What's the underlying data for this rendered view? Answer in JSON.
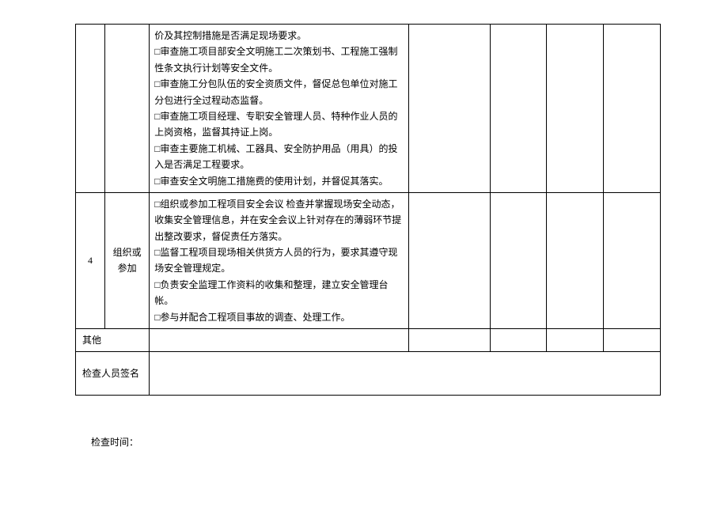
{
  "row3": {
    "items": [
      "价及其控制措施是否满足现场要求。",
      "□审查施工项目部安全文明施工二次策划书、工程施工强制性条文执行计划等安全文件。",
      "□审查施工分包队伍的安全资质文件，督促总包单位对施工分包进行全过程动态监督。",
      "□审查施工项目经理、专职安全管理人员、特种作业人员的上岗资格，监督其持证上岗。",
      "□审查主要施工机械、工器具、安全防护用品（用具）的投入是否满足工程要求。",
      "□审查安全文明施工措施费的使用计划，并督促其落实。"
    ]
  },
  "row4": {
    "index": "4",
    "category": "组织或参加",
    "items": [
      "□组织或参加工程项目安全会议 检查并掌握现场安全动态，收集安全管理信息，并在安全会议上针对存在的薄弱环节提出整改要求，督促责任方落实。",
      "□监督工程项目现场相关供货方人员的行为，要求其遵守现场安全管理规定。",
      "□负责安全监理工作资料的收集和整理，建立安全管理台帐。",
      "□参与并配合工程项目事故的调查、处理工作。"
    ]
  },
  "other_label": "其他",
  "sign_label": "检查人员签名",
  "footer": "检查时间："
}
